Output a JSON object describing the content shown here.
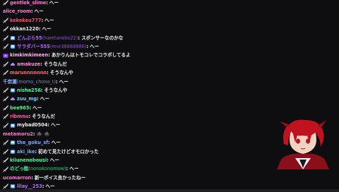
{
  "messages": [
    {
      "badges": [
        "sword"
      ],
      "user": "gentlek_slime",
      "alt": "",
      "text": "へー",
      "color": "#ff7ad9"
    },
    {
      "badges": [],
      "user": "alice_room",
      "alt": "",
      "text": "へー",
      "color": "#ff7ad9"
    },
    {
      "badges": [
        "sword"
      ],
      "user": "kekekeu777",
      "alt": "",
      "text": "へー",
      "color": "#ff4d6d"
    },
    {
      "badges": [
        "sword"
      ],
      "user": "okkan1220",
      "alt": "",
      "text": "へー",
      "color": "#efeff1"
    },
    {
      "badges": [
        "sword",
        "sub"
      ],
      "user": "どんぶら55",
      "alt": "(haretaneko22)",
      "text": "スポンサーなのかな",
      "color": "#b565ff"
    },
    {
      "badges": [
        "sword",
        "sub"
      ],
      "user": "サラダバー555",
      "alt": "(mvr38888888)",
      "text": "へー",
      "color": "#b565ff"
    },
    {
      "badges": [
        "video"
      ],
      "user": "kimkimkimeen",
      "alt": "",
      "text": "あかりんはトモコレでコラボしてるよ",
      "color": "#ffb4f2"
    },
    {
      "badges": [
        "sword",
        "cloud"
      ],
      "user": "amakuze",
      "alt": "",
      "text": "そうなんだ",
      "color": "#ff8bd8"
    },
    {
      "badges": [
        "sword"
      ],
      "user": "marunnnnnnn",
      "alt": "",
      "text": "そうなんや",
      "color": "#ff6b6b"
    },
    {
      "badges": [],
      "user": "千奈瀬",
      "alt": "(momo_chono_t)",
      "text": "へー",
      "color": "#8ab4ff"
    },
    {
      "badges": [
        "sword",
        "sub"
      ],
      "user": "nisha256",
      "alt": "",
      "text": "そうなんや",
      "color": "#3cff9f"
    },
    {
      "badges": [
        "sword",
        "cloud"
      ],
      "user": "zuu_mg",
      "alt": "",
      "text": "へー",
      "color": "#6ad0ff"
    },
    {
      "badges": [
        "sword"
      ],
      "user": "bee965",
      "alt": "",
      "text": "へー",
      "color": "#3cff9f"
    },
    {
      "badges": [
        "sword"
      ],
      "user": "ribmnu",
      "alt": "",
      "text": "そうなんだ",
      "color": "#ff5cad"
    },
    {
      "badges": [
        "sword",
        "sub"
      ],
      "user": "mybad0504",
      "alt": "",
      "text": "へー",
      "color": "#efeff1"
    },
    {
      "badges": [],
      "user": "metamoru2",
      "alt": "",
      "text": "🕷️ 🕷️",
      "color": "#ff79c6"
    },
    {
      "badges": [
        "sword",
        "sub"
      ],
      "user": "the_goku_sf",
      "alt": "",
      "text": "へー",
      "color": "#7da7ff"
    },
    {
      "badges": [
        "sword",
        "sub"
      ],
      "user": "aki_ike",
      "alt": "",
      "text": "初めて見たけどオモロかった",
      "color": "#6aa8ff"
    },
    {
      "badges": [
        "sword"
      ],
      "user": "kiiunenobousi",
      "alt": "",
      "text": "へー",
      "color": "#3cff9f"
    },
    {
      "badges": [
        "sword"
      ],
      "user": "のどっ飴",
      "alt": "(nonokonomow)",
      "text": "へー",
      "color": "#3cff9f"
    },
    {
      "badges": [],
      "user": "ucomarron",
      "alt": "",
      "text": "新一ボイス良かったねー",
      "color": "#ff7ad9"
    },
    {
      "badges": [
        "sword",
        "sub"
      ],
      "user": "lllay__253",
      "alt": "",
      "text": "へー",
      "color": "#b565ff"
    }
  ],
  "avatar_label": "streamer avatar"
}
